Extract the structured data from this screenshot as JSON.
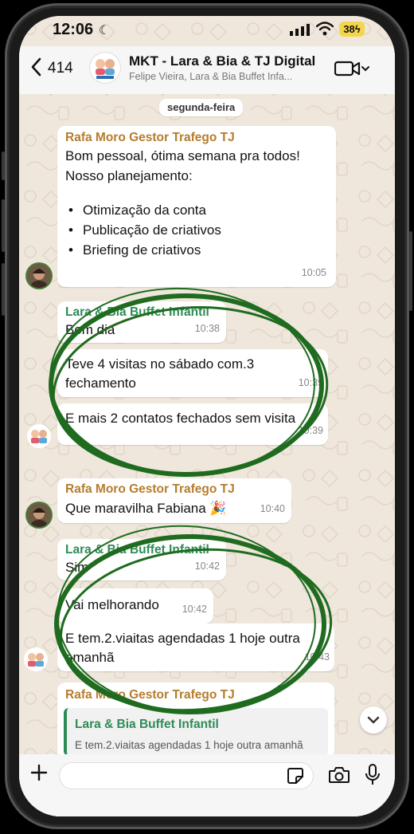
{
  "status_bar": {
    "time": "12:06",
    "battery": "38"
  },
  "header": {
    "back_count": "414",
    "title": "MKT - Lara & Bia & TJ Digital",
    "subtitle": "Felipe Vieira, Lara & Bia Buffet Infa..."
  },
  "chat": {
    "date_chip": "segunda-feira",
    "messages": [
      {
        "sender": "Rafa Moro Gestor Trafego TJ",
        "line1": "Bom pessoal, ótima semana pra todos!",
        "line2": "Nosso planejamento:",
        "bullets": [
          "Otimização da conta",
          "Publicação de criativos",
          "Briefing de criativos"
        ],
        "time": "10:05"
      },
      {
        "sender": "Lara & Bia Buffet Infantil",
        "text": "Bom dia",
        "time": "10:38"
      },
      {
        "line1": "Teve 4 visitas no sábado com.3",
        "line2": "fechamento",
        "time": "10:39"
      },
      {
        "text": "E mais 2 contatos fechados sem visita",
        "time": "10:39"
      },
      {
        "sender": "Rafa Moro Gestor Trafego TJ",
        "text": "Que maravilha Fabiana 🎉",
        "time": "10:40"
      },
      {
        "sender": "Lara & Bia Buffet Infantil",
        "text": "Sim",
        "time": "10:42"
      },
      {
        "text": "Vai melhorando",
        "time": "10:42"
      },
      {
        "line1": "E tem.2.viaitas agendadas 1 hoje outra",
        "line2": "amanhã",
        "time": "10:43"
      },
      {
        "sender": "Rafa Moro Gestor Trafego TJ",
        "quote_name": "Lara & Bia Buffet Infantil",
        "quote_text": "E tem.2.viaitas agendadas 1 hoje outra amanhã"
      }
    ]
  },
  "colors": {
    "wallpaper": "#efe7dc",
    "sender_orange": "#b47d2c",
    "sender_green": "#2e8b57",
    "circle": "#1f6b1f"
  }
}
